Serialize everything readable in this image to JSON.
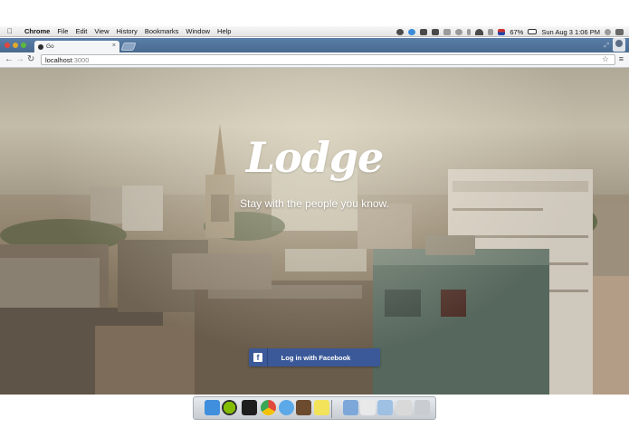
{
  "menubar": {
    "app_name": "Chrome",
    "menus": [
      "File",
      "Edit",
      "View",
      "History",
      "Bookmarks",
      "Window",
      "Help"
    ],
    "battery": "67%",
    "clock": "Sun Aug 3  1:06 PM"
  },
  "browser": {
    "tab_title": "Go",
    "tab_close": "×",
    "url_host": "localhost",
    "url_port": ":3000",
    "back": "←",
    "forward": "→",
    "reload": "↻",
    "star": "☆",
    "menu": "≡"
  },
  "page": {
    "logo": "Lodge",
    "tagline": "Stay with the people you know.",
    "login_button": "Log in with Facebook",
    "facebook_icon_glyph": "f"
  },
  "dock": {
    "apps": [
      {
        "name": "finder-icon",
        "color": "#3f8fdc"
      },
      {
        "name": "spotify-icon",
        "color": "#2e2e2e"
      },
      {
        "name": "terminal-icon",
        "color": "#1e1e1e"
      },
      {
        "name": "chrome-icon",
        "color": "#e2483b"
      },
      {
        "name": "messages-icon",
        "color": "#5ba9e8"
      },
      {
        "name": "iphoto-icon",
        "color": "#6d4b2f"
      },
      {
        "name": "stickies-icon",
        "color": "#f2e35a"
      },
      {
        "name": "documents-folder-icon",
        "color": "#7da7d9"
      },
      {
        "name": "file-icon",
        "color": "#e9e9e9"
      },
      {
        "name": "folder-icon",
        "color": "#9ec0e3"
      },
      {
        "name": "preview-icon",
        "color": "#d9d9d9"
      },
      {
        "name": "trash-icon",
        "color": "#c9cdd2"
      }
    ]
  }
}
